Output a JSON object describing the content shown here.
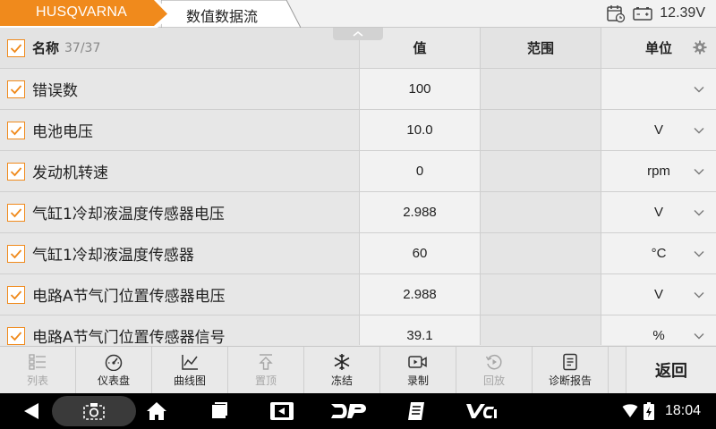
{
  "header": {
    "brand": "HUSQVARNA",
    "title": "数值数据流",
    "battery_voltage": "12.39V",
    "colors": {
      "brand_tab": "#f08a1c",
      "accent": "#f08a1c"
    }
  },
  "table": {
    "columns": {
      "name": "名称",
      "count": "37/37",
      "value": "值",
      "range": "范围",
      "unit": "单位"
    },
    "rows": [
      {
        "name": "错误数",
        "value": "100",
        "range": "",
        "unit": ""
      },
      {
        "name": "电池电压",
        "value": "10.0",
        "range": "",
        "unit": "V"
      },
      {
        "name": "发动机转速",
        "value": "0",
        "range": "",
        "unit": "rpm"
      },
      {
        "name": "气缸1冷却液温度传感器电压",
        "value": "2.988",
        "range": "",
        "unit": "V"
      },
      {
        "name": "气缸1冷却液温度传感器",
        "value": "60",
        "range": "",
        "unit": "°C"
      },
      {
        "name": "电路A节气门位置传感器电压",
        "value": "2.988",
        "range": "",
        "unit": "V"
      },
      {
        "name": "电路A节气门位置传感器信号",
        "value": "39.1",
        "range": "",
        "unit": "%"
      }
    ]
  },
  "toolbar": {
    "list": "列表",
    "gauge": "仪表盘",
    "graph": "曲线图",
    "pin_top": "置顶",
    "freeze": "冻结",
    "record": "录制",
    "playback": "回放",
    "report": "诊断报告",
    "back": "返回"
  },
  "navbar": {
    "time": "18:04"
  }
}
